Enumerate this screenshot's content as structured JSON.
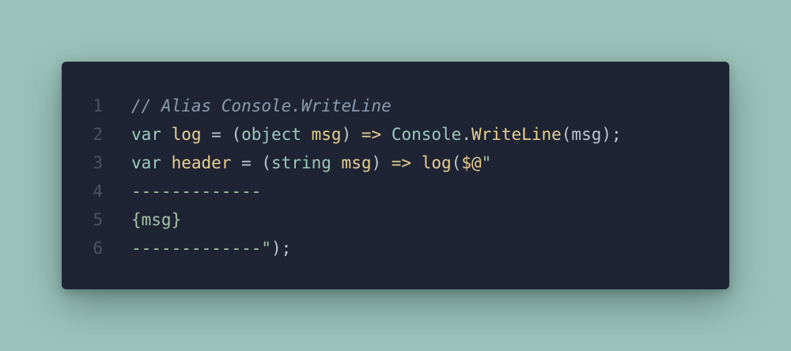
{
  "code_window": {
    "colors": {
      "page_background": "#9cc3bb",
      "editor_background": "#1e2433",
      "line_number": "#4a5366",
      "comment": "#8c9bb0",
      "keyword": "#9ec9bd",
      "identifier": "#e9d092",
      "string": "#a4c4a8"
    },
    "lines": [
      {
        "number": "1",
        "tokens": [
          {
            "type": "comment",
            "text": "// Alias Console.WriteLine"
          }
        ]
      },
      {
        "number": "2",
        "tokens": [
          {
            "type": "keyword",
            "text": "var"
          },
          {
            "type": "punct",
            "text": " "
          },
          {
            "type": "ident",
            "text": "log"
          },
          {
            "type": "punct",
            "text": " = ("
          },
          {
            "type": "type",
            "text": "object"
          },
          {
            "type": "punct",
            "text": " "
          },
          {
            "type": "ident",
            "text": "msg"
          },
          {
            "type": "punct",
            "text": ") "
          },
          {
            "type": "ident",
            "text": "=>"
          },
          {
            "type": "punct",
            "text": " "
          },
          {
            "type": "type",
            "text": "Console"
          },
          {
            "type": "punct",
            "text": "."
          },
          {
            "type": "method",
            "text": "WriteLine"
          },
          {
            "type": "punct",
            "text": "(msg);"
          }
        ]
      },
      {
        "number": "3",
        "tokens": [
          {
            "type": "keyword",
            "text": "var"
          },
          {
            "type": "punct",
            "text": " "
          },
          {
            "type": "ident",
            "text": "header"
          },
          {
            "type": "punct",
            "text": " = ("
          },
          {
            "type": "type",
            "text": "string"
          },
          {
            "type": "punct",
            "text": " "
          },
          {
            "type": "ident",
            "text": "msg"
          },
          {
            "type": "punct",
            "text": ") "
          },
          {
            "type": "ident",
            "text": "=>"
          },
          {
            "type": "punct",
            "text": " "
          },
          {
            "type": "method",
            "text": "log"
          },
          {
            "type": "punct",
            "text": "("
          },
          {
            "type": "ident",
            "text": "$@"
          },
          {
            "type": "string",
            "text": "\""
          }
        ]
      },
      {
        "number": "4",
        "tokens": [
          {
            "type": "string",
            "text": "-------------"
          }
        ]
      },
      {
        "number": "5",
        "tokens": [
          {
            "type": "string",
            "text": "{msg}"
          }
        ]
      },
      {
        "number": "6",
        "tokens": [
          {
            "type": "string",
            "text": "-------------\""
          },
          {
            "type": "punct",
            "text": ");"
          }
        ]
      }
    ]
  }
}
